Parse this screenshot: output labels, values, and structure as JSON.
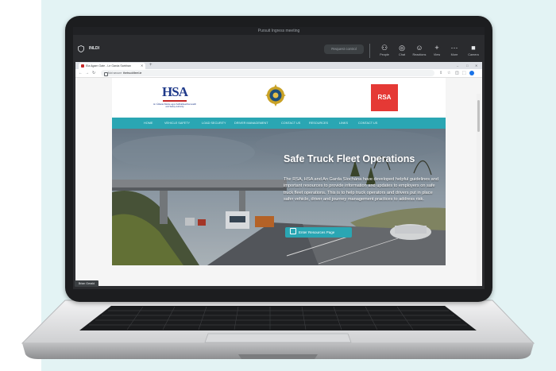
{
  "meet": {
    "window_title": "Pursuit Ingress meeting",
    "meeting_name": "INLDI",
    "request_control": "Request control",
    "tools": [
      {
        "label": "People",
        "icon": "people-icon"
      },
      {
        "label": "Chat",
        "icon": "chat-icon"
      },
      {
        "label": "Reactions",
        "icon": "reactions-icon"
      },
      {
        "label": "View",
        "icon": "view-icon"
      },
      {
        "label": "More",
        "icon": "more-icon"
      },
      {
        "label": "Camera",
        "icon": "camera-icon"
      }
    ],
    "presenter_badge": "Brian Gerald"
  },
  "browser": {
    "tab_title": "Ela Agam Gate - Le Garda Sarbhan",
    "new_tab": "+",
    "omnibox": {
      "security": "Not secure",
      "url": "thetruckfleet.ie"
    }
  },
  "site": {
    "hsa": {
      "mark": "HSA",
      "sub": "An tÚdarás Sláinte agus Sábháilteachta Health and Safety Authority"
    },
    "rsa": {
      "mark": "RSA"
    },
    "nav": [
      "HOME",
      "VEHICLE SAFETY",
      "LOAD SECURITY",
      "DRIVER MANAGEMENT",
      "CONTACT US",
      "RESOURCES",
      "LINKS",
      "CONTACT US"
    ],
    "hero": {
      "title": "Safe Truck Fleet Operations",
      "body": "The RSA, HSA and An Garda Síochána have developed helpful guidelines and important resources to provide information and updates to employers on safe truck fleet operations. This is to help truck operators and drivers put in place safer vehicle, driver and journey management practices to address risk.",
      "cta": "Enter Resources Page"
    }
  },
  "colors": {
    "accent": "#2aa6b3",
    "rsa_red": "#e53935",
    "hsa_blue": "#1f3a8a",
    "panel": "#e3f3f4"
  }
}
